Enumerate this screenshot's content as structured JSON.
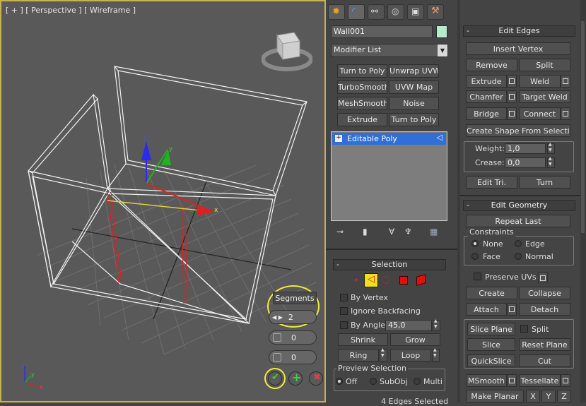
{
  "viewport": {
    "label": "[ + ] [ Perspective ] [ Wireframe ]",
    "axis_labels": {
      "x": "x",
      "y": "y",
      "z": "z"
    },
    "caddy": {
      "title": "Segments",
      "segments_value": "2",
      "pinch_value": "0",
      "slide_value": "0"
    }
  },
  "command_panel": {
    "tabs": [
      "create-icon",
      "modify-icon",
      "hierarchy-icon",
      "motion-icon",
      "display-icon",
      "utilities-icon"
    ],
    "object_name": "Wall001",
    "object_color": "#b6ecc9",
    "modifier_list": "Modifier List",
    "modifier_buttons": [
      "Turn to Poly",
      "Unwrap UVW",
      "TurboSmooth",
      "UVW Map",
      "MeshSmooth",
      "Noise",
      "Extrude",
      "Turn to Poly"
    ],
    "stack_item": "Editable Poly",
    "selection": {
      "title": "Selection",
      "by_vertex": "By Vertex",
      "ignore_backfacing": "Ignore Backfacing",
      "by_angle": "By Angle:",
      "angle_value": "45,0",
      "shrink": "Shrink",
      "grow": "Grow",
      "ring": "Ring",
      "loop": "Loop",
      "preview_title": "Preview Selection",
      "preview_off": "Off",
      "preview_subobj": "SubObj",
      "preview_multi": "Multi",
      "status": "4 Edges Selected"
    }
  },
  "edit_edges": {
    "title": "Edit Edges",
    "insert_vertex": "Insert Vertex",
    "remove": "Remove",
    "split": "Split",
    "extrude": "Extrude",
    "weld": "Weld",
    "chamfer": "Chamfer",
    "target_weld": "Target Weld",
    "bridge": "Bridge",
    "connect": "Connect",
    "create_shape": "Create Shape From Selection",
    "weight_label": "Weight:",
    "weight_value": "1,0",
    "crease_label": "Crease:",
    "crease_value": "0,0",
    "edit_tri": "Edit Tri.",
    "turn": "Turn"
  },
  "edit_geometry": {
    "title": "Edit Geometry",
    "repeat_last": "Repeat Last",
    "constraints_title": "Constraints",
    "none": "None",
    "edge": "Edge",
    "face": "Face",
    "normal": "Normal",
    "preserve_uvs": "Preserve UVs",
    "create": "Create",
    "collapse": "Collapse",
    "attach": "Attach",
    "detach": "Detach",
    "slice_plane": "Slice Plane",
    "split": "Split",
    "slice": "Slice",
    "reset_plane": "Reset Plane",
    "quickslice": "QuickSlice",
    "cut": "Cut",
    "msmooth": "MSmooth",
    "tessellate": "Tessellate",
    "make_planar": "Make Planar",
    "x": "X",
    "y": "Y",
    "z": "Z"
  }
}
